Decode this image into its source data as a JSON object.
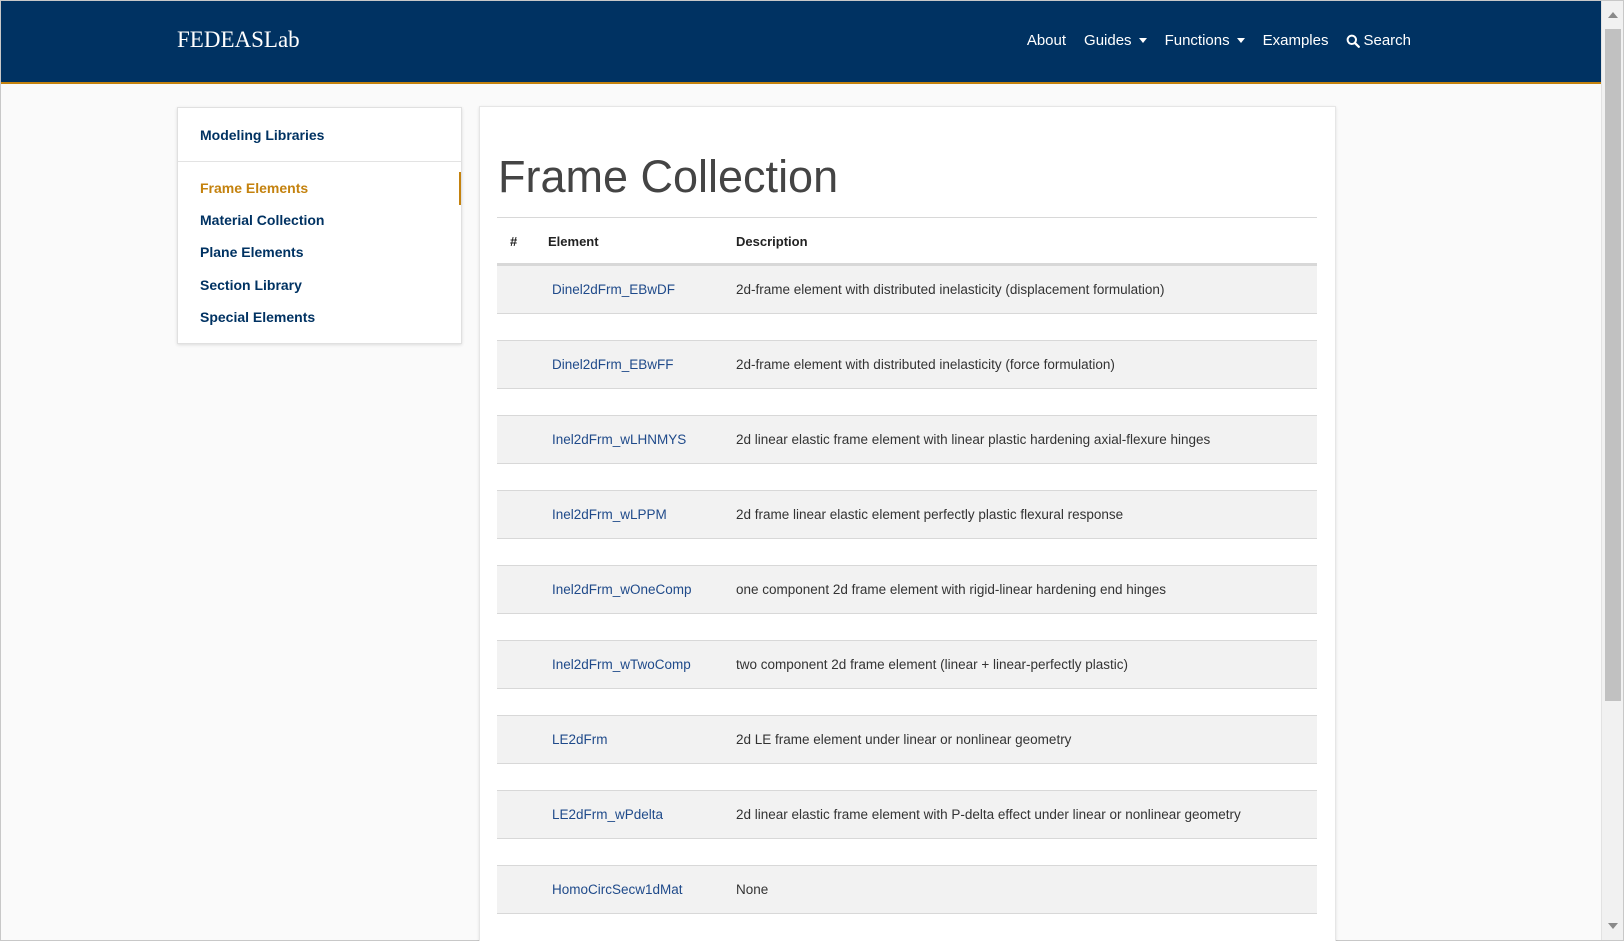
{
  "header": {
    "brand": "FEDEASLab",
    "nav": {
      "about": "About",
      "guides": "Guides",
      "functions": "Functions",
      "examples": "Examples",
      "search": "Search"
    }
  },
  "sidebar": {
    "title": "Modeling Libraries",
    "items": [
      {
        "label": "Frame Elements",
        "active": true
      },
      {
        "label": "Material Collection",
        "active": false
      },
      {
        "label": "Plane Elements",
        "active": false
      },
      {
        "label": "Section Library",
        "active": false
      },
      {
        "label": "Special Elements",
        "active": false
      }
    ]
  },
  "main": {
    "title": "Frame Collection",
    "table": {
      "headers": {
        "num": "#",
        "element": "Element",
        "description": "Description"
      },
      "rows": [
        {
          "element": "Dinel2dFrm_EBwDF",
          "description": "2d-frame element with distributed inelasticity (displacement formulation)"
        },
        {
          "element": "Dinel2dFrm_EBwFF",
          "description": "2d-frame element with distributed inelasticity (force formulation)"
        },
        {
          "element": "Inel2dFrm_wLHNMYS",
          "description": "2d linear elastic frame element with linear plastic hardening axial-flexure hinges"
        },
        {
          "element": "Inel2dFrm_wLPPM",
          "description": "2d frame linear elastic element perfectly plastic flexural response"
        },
        {
          "element": "Inel2dFrm_wOneComp",
          "description": "one component 2d frame element with rigid-linear hardening end hinges"
        },
        {
          "element": "Inel2dFrm_wTwoComp",
          "description": "two component 2d frame element (linear + linear-perfectly plastic)"
        },
        {
          "element": "LE2dFrm",
          "description": "2d LE frame element under linear or nonlinear geometry"
        },
        {
          "element": "LE2dFrm_wPdelta",
          "description": "2d linear elastic frame element with P-delta effect under linear or nonlinear geometry"
        },
        {
          "element": "HomoCircSecw1dMat",
          "description": "None"
        }
      ]
    }
  },
  "colors": {
    "navbar": "#003262",
    "accent": "#c4820e",
    "link": "#1f4a8a"
  }
}
